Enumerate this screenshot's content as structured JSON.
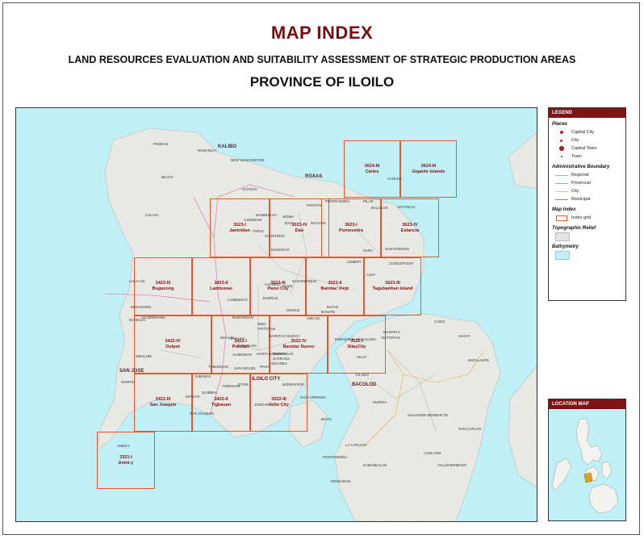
{
  "header": {
    "title": "MAP INDEX",
    "subtitle": "LAND RESOURCES EVALUATION AND SUITABILITY ASSESSMENT OF STRATEGIC PRODUCTION AREAS",
    "province": "PROVINCE OF ILOILO"
  },
  "index_cells": [
    {
      "code": "3624-III",
      "name": "Carles"
    },
    {
      "code": "3624-III",
      "name": "Gigante Islands"
    },
    {
      "code": "3523-I",
      "name": "Jamindan"
    },
    {
      "code": "3523-IV",
      "name": "Dao"
    },
    {
      "code": "3623-I",
      "name": "Pontevedra"
    },
    {
      "code": "3623-IV",
      "name": "Estancia"
    },
    {
      "code": "3423-III",
      "name": "Bugasong"
    },
    {
      "code": "3423-II",
      "name": "Lambunao"
    },
    {
      "code": "3523-III",
      "name": "Passi City"
    },
    {
      "code": "3523-II",
      "name": "Barotac Viejo"
    },
    {
      "code": "3623-III",
      "name": "Tagubanhan Island"
    },
    {
      "code": "3422-IV",
      "name": "Oulpot"
    },
    {
      "code": "3422-I",
      "name": "Pototan"
    },
    {
      "code": "3522-IV",
      "name": "Barotac Nuevo"
    },
    {
      "code": "3522-I",
      "name": "SilayCity"
    },
    {
      "code": "3422-III",
      "name": "San Joaquin"
    },
    {
      "code": "3422-II",
      "name": "Tigbauan"
    },
    {
      "code": "3522-III",
      "name": "Iloilo City"
    },
    {
      "code": "3321-I",
      "name": "Anini-y"
    }
  ],
  "places": [
    {
      "name": "ROXAS",
      "type": "capital"
    },
    {
      "name": "KALIBO",
      "type": "capital"
    },
    {
      "name": "ILOILO CITY",
      "type": "capital"
    },
    {
      "name": "BACOLOD",
      "type": "capital"
    },
    {
      "name": "SAN JOSE",
      "type": "capital"
    },
    {
      "name": "CARLES",
      "type": "town"
    },
    {
      "name": "PASSI",
      "type": "town"
    },
    {
      "name": "ESTANCIA",
      "type": "town"
    },
    {
      "name": "SARA",
      "type": "town"
    },
    {
      "name": "JORDAN",
      "type": "town"
    },
    {
      "name": "POTOTAN",
      "type": "town"
    },
    {
      "name": "DINGLE",
      "type": "town"
    },
    {
      "name": "BAROTAC NUEVO",
      "type": "town"
    },
    {
      "name": "DUMANGAS",
      "type": "town"
    },
    {
      "name": "JANIUAY",
      "type": "town"
    },
    {
      "name": "LEGANES",
      "type": "town"
    },
    {
      "name": "CALINOG",
      "type": "town"
    },
    {
      "name": "CUARTERO",
      "type": "town"
    },
    {
      "name": "DAO",
      "type": "town"
    },
    {
      "name": "TAPAZ",
      "type": "town"
    },
    {
      "name": "MAAYON",
      "type": "town"
    },
    {
      "name": "PONTEVEDRA",
      "type": "town"
    },
    {
      "name": "PILAR",
      "type": "town"
    },
    {
      "name": "BALASAN",
      "type": "town"
    },
    {
      "name": "LEMERY",
      "type": "town"
    },
    {
      "name": "AJUY",
      "type": "town"
    },
    {
      "name": "CONCEPCION",
      "type": "town"
    },
    {
      "name": "SAN DIONISIO",
      "type": "town"
    },
    {
      "name": "BATAD",
      "type": "town"
    },
    {
      "name": "BANATE",
      "type": "town"
    },
    {
      "name": "ANILAO",
      "type": "town"
    },
    {
      "name": "ZARRAGA",
      "type": "town"
    },
    {
      "name": "MIAGAO",
      "type": "town"
    },
    {
      "name": "SAN JOAQUIN",
      "type": "town"
    },
    {
      "name": "GUIMBAL",
      "type": "town"
    },
    {
      "name": "TIGBAUAN",
      "type": "town"
    },
    {
      "name": "ANINI-Y",
      "type": "town"
    },
    {
      "name": "HAMTIC",
      "type": "town"
    },
    {
      "name": "BARBAZA",
      "type": "town"
    },
    {
      "name": "CULASI",
      "type": "town"
    },
    {
      "name": "LAUA-AN",
      "type": "town"
    },
    {
      "name": "BUGASONG",
      "type": "town"
    },
    {
      "name": "VALDERRAMA",
      "type": "town"
    },
    {
      "name": "SIBALOM",
      "type": "town"
    },
    {
      "name": "CADIZ",
      "type": "town"
    },
    {
      "name": "SAGAY",
      "type": "town"
    },
    {
      "name": "VICTORIAS",
      "type": "town"
    },
    {
      "name": "SILAY",
      "type": "town"
    },
    {
      "name": "TALISAY",
      "type": "town"
    },
    {
      "name": "MURCIA",
      "type": "town"
    },
    {
      "name": "BAGO",
      "type": "town"
    },
    {
      "name": "LA CARLOTA",
      "type": "town"
    },
    {
      "name": "KABANKALAN",
      "type": "town"
    },
    {
      "name": "SAN CARLOS",
      "type": "town"
    },
    {
      "name": "CANLAON",
      "type": "town"
    },
    {
      "name": "HINIGARAN",
      "type": "town"
    },
    {
      "name": "ESCALANTE",
      "type": "town"
    },
    {
      "name": "SALVADOR BENEDICTO",
      "type": "town"
    },
    {
      "name": "VALLEHERMOSO",
      "type": "town"
    },
    {
      "name": "PONTEVEDRA",
      "type": "town"
    },
    {
      "name": "PANDAN",
      "type": "town"
    },
    {
      "name": "NUMANCIA",
      "type": "town"
    },
    {
      "name": "NEW WASHINGTON",
      "type": "town"
    },
    {
      "name": "IBAJAY",
      "type": "town"
    },
    {
      "name": "ALTAVAS",
      "type": "town"
    },
    {
      "name": "DUMARAO",
      "type": "town"
    },
    {
      "name": "SIGMA",
      "type": "town"
    },
    {
      "name": "PANITAN",
      "type": "town"
    },
    {
      "name": "MAMBUSAO",
      "type": "town"
    },
    {
      "name": "JAMINDAN",
      "type": "town"
    },
    {
      "name": "LAMBUNAO",
      "type": "town"
    },
    {
      "name": "MAASIN",
      "type": "town"
    },
    {
      "name": "ALIMODIAN",
      "type": "town"
    },
    {
      "name": "CABATUAN",
      "type": "town"
    },
    {
      "name": "SANTA BARBARA",
      "type": "town"
    },
    {
      "name": "SAN MIGUEL",
      "type": "town"
    },
    {
      "name": "PAVIA",
      "type": "town"
    },
    {
      "name": "OTON",
      "type": "town"
    },
    {
      "name": "BUENAVISTA",
      "type": "town"
    },
    {
      "name": "SAN LORENZO",
      "type": "town"
    },
    {
      "name": "SAN ENRIQUE",
      "type": "town"
    },
    {
      "name": "ENRIQUE B. MAGALONA",
      "type": "town"
    },
    {
      "name": "MANAPLA",
      "type": "town"
    },
    {
      "name": "DUEÑAS",
      "type": "town"
    },
    {
      "name": "MINA",
      "type": "town"
    },
    {
      "name": "BADIANGAN",
      "type": "town"
    },
    {
      "name": "TUBUNGAN",
      "type": "town"
    },
    {
      "name": "IGBARAS",
      "type": "town"
    }
  ],
  "legend": {
    "title": "LEGEND",
    "places_title": "Places",
    "places": [
      "Capital City",
      "City",
      "Capital Town",
      "Town"
    ],
    "boundary_title": "Administrative Boundary",
    "boundaries": [
      "Regional",
      "Provincial",
      "City",
      "Municipal"
    ],
    "index_title": "Map Index",
    "index_item": "Index grid",
    "relief_title": "Topographic Relief",
    "bathy_title": "Bathymetry",
    "colors": {
      "regional": "#e0b030",
      "provincial": "#e080c0",
      "city": "#d8d860",
      "municipal": "#888888",
      "index_grid": "#e8562a",
      "capital": "#c0262c",
      "water": "#bff0f6"
    }
  },
  "location_map": {
    "title": "LOCATION MAP"
  }
}
